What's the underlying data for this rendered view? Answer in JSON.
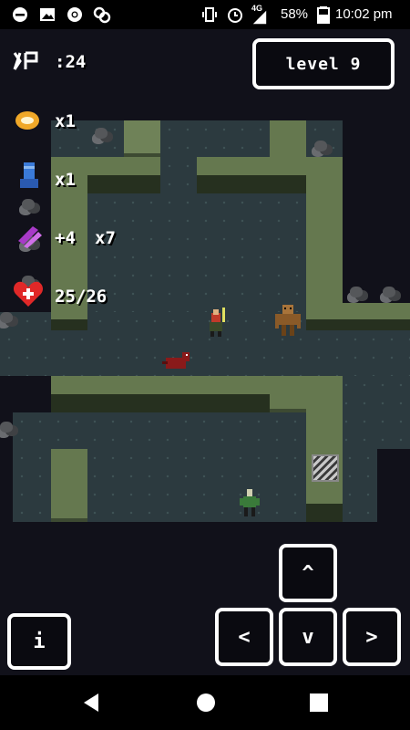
{
  "status_bar": {
    "network": "4G",
    "battery": "58%",
    "time": "10:02 pm"
  },
  "hud": {
    "xp_label": "XP",
    "xp_value": ":24",
    "level": "level 9",
    "ring_count": "x1",
    "boot_count": "x1",
    "weapon_bonus": "+4",
    "weapon_count": "x7",
    "health": "25/26"
  },
  "controls": {
    "info_label": "i",
    "up_label": "^",
    "left_label": "<",
    "down_label": "v",
    "right_label": ">"
  },
  "icons": {
    "xp": "xp-badge-icon",
    "ring": "gold-ring-icon",
    "boot": "blue-boot-icon",
    "weapon": "purple-crystal-icon",
    "health": "red-heart-icon"
  },
  "colors": {
    "floor": "#2c3a3f",
    "wall": "#65784f",
    "heart": "#e02828",
    "ring": "#f0a828",
    "boot": "#3a7ad8",
    "crystal": "#a83ac8"
  }
}
